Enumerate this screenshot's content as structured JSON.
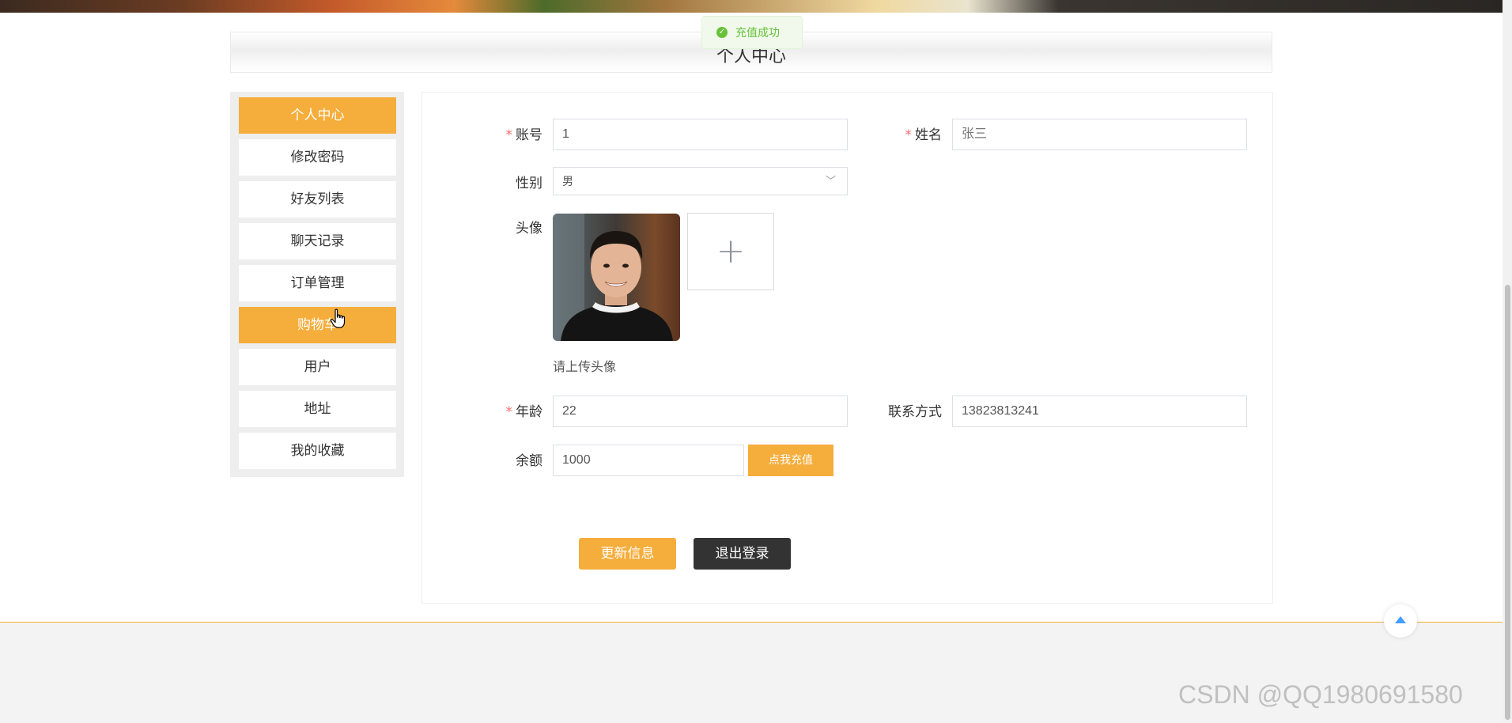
{
  "page": {
    "title": "个人中心",
    "toast": "充值成功",
    "watermark": "CSDN @QQ1980691580"
  },
  "sidebar": {
    "items": [
      {
        "label": "个人中心",
        "active": true
      },
      {
        "label": "修改密码",
        "active": false
      },
      {
        "label": "好友列表",
        "active": false
      },
      {
        "label": "聊天记录",
        "active": false
      },
      {
        "label": "订单管理",
        "active": false
      },
      {
        "label": "购物车",
        "active": true
      },
      {
        "label": "用户",
        "active": false
      },
      {
        "label": "地址",
        "active": false
      },
      {
        "label": "我的收藏",
        "active": false
      }
    ]
  },
  "form": {
    "account_label": "账号",
    "account_value": "1",
    "name_label": "姓名",
    "name_value": "张三",
    "gender_label": "性别",
    "gender_value": "男",
    "avatar_label": "头像",
    "avatar_hint": "请上传头像",
    "age_label": "年龄",
    "age_value": "22",
    "contact_label": "联系方式",
    "contact_value": "13823813241",
    "balance_label": "余额",
    "balance_value": "1000",
    "recharge_label": "点我充值",
    "update_label": "更新信息",
    "logout_label": "退出登录",
    "required_mark": "*"
  },
  "colors": {
    "accent": "#f5ad3b",
    "dark_button": "#333333",
    "toast_success": "#67c23a",
    "required": "#f56c6c"
  },
  "icons": {
    "toast": "check-circle-icon",
    "upload": "plus-icon",
    "gender_select": "chevron-down-icon",
    "back_to_top": "caret-up-icon"
  }
}
